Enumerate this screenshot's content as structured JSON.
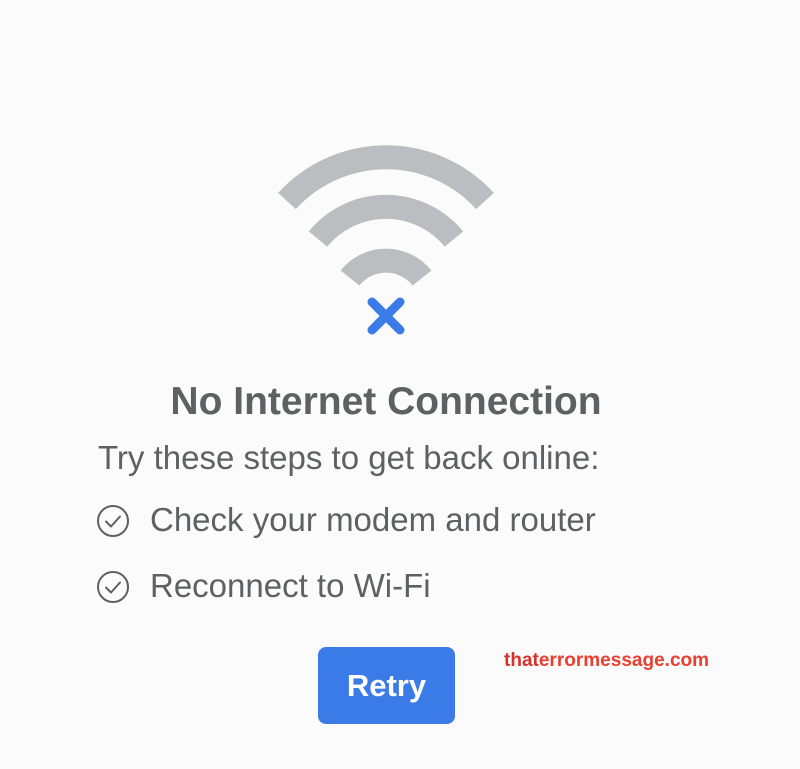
{
  "colors": {
    "background": "#fbfbfb",
    "text": "#5f6062",
    "wifi_arcs": "#bbbdc0",
    "error_mark": "#3b7be8",
    "button": "#3b7be8",
    "button_text": "#ffffff",
    "watermark": "#e8402f"
  },
  "icons": {
    "status": "wifi-off-icon",
    "step": "check-circle-icon"
  },
  "dialog": {
    "title": "No Internet Connection",
    "subtitle": "Try these steps to get back online:",
    "steps": [
      {
        "label": "Check your modem and router"
      },
      {
        "label": "Reconnect to Wi-Fi"
      }
    ],
    "retry_label": "Retry"
  },
  "watermark": {
    "text": "thaterrormessage.com"
  }
}
